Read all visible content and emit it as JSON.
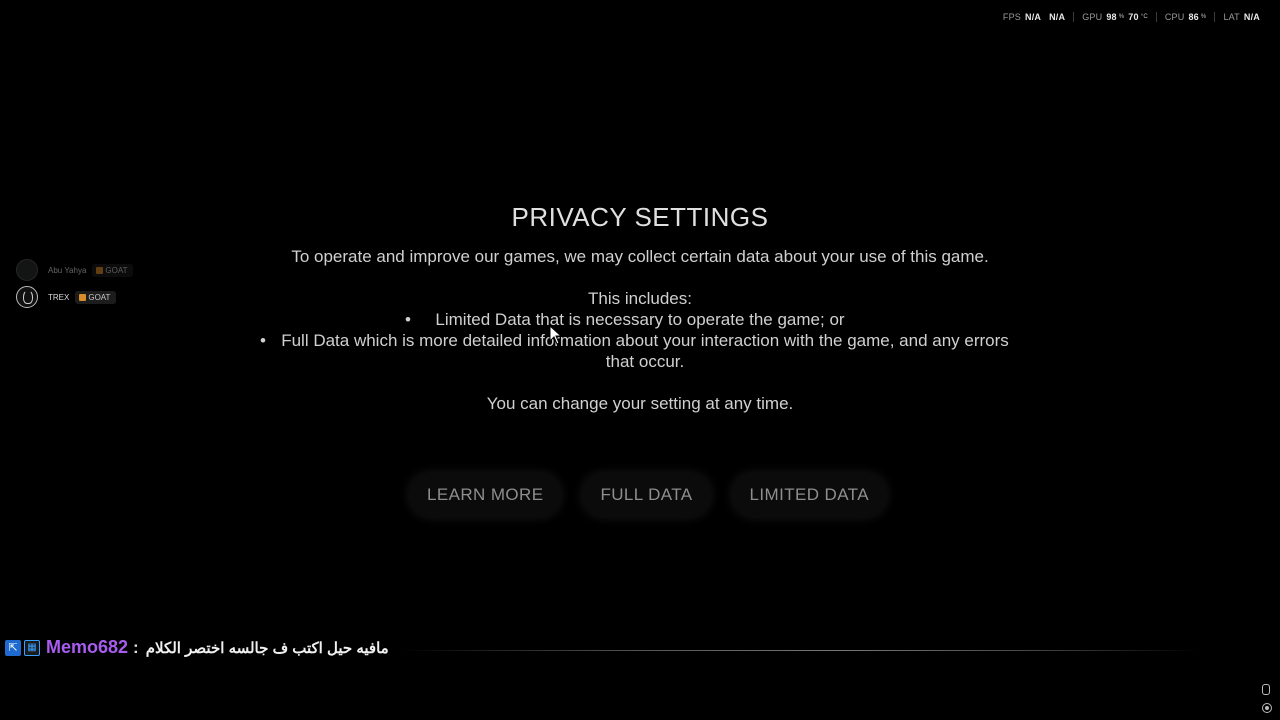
{
  "perf": {
    "fps_label": "FPS",
    "fps_value_1": "N/A",
    "fps_value_2": "N/A",
    "gpu_label": "GPU",
    "gpu_usage": "98",
    "gpu_usage_unit": "%",
    "gpu_temp": "70",
    "gpu_temp_unit": "°C",
    "cpu_label": "CPU",
    "cpu_usage": "86",
    "cpu_usage_unit": "%",
    "lat_label": "LAT",
    "lat_value": "N/A"
  },
  "party": {
    "members": [
      {
        "name": "Abu Yahya",
        "badge": "GOAT"
      },
      {
        "name": "TREX",
        "badge": "GOAT"
      }
    ]
  },
  "dialog": {
    "title": "PRIVACY SETTINGS",
    "description": "To operate and improve our games, we may collect certain data about your use of this game.",
    "includes_label": "This includes:",
    "bullet_1": "Limited Data that is necessary to operate the game; or",
    "bullet_2": "Full Data which is more detailed information about your interaction with the game, and any errors that occur.",
    "change_note": "You can change your setting at any time."
  },
  "buttons": {
    "learn_more": "LEARN MORE",
    "full_data": "FULL DATA",
    "limited_data": "LIMITED DATA"
  },
  "chat": {
    "username": "Memo682",
    "separator": ":",
    "message": "مافيه حيل اكتب ف جالسه اختصر الكلام"
  }
}
